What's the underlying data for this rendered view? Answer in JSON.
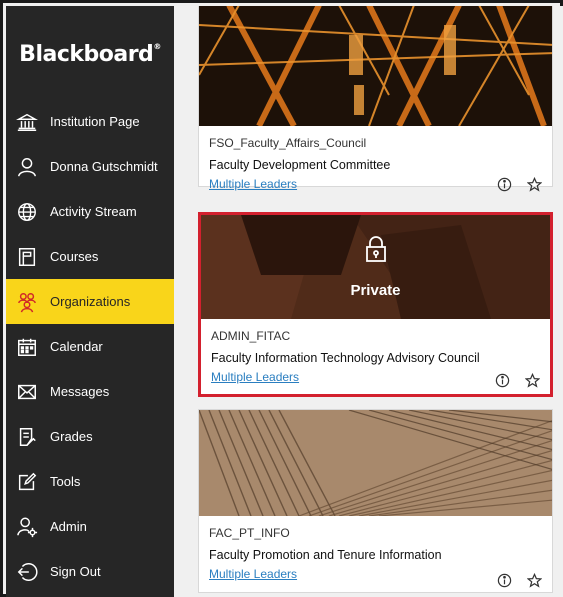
{
  "brand": "Blackboard",
  "nav": [
    {
      "label": "Institution Page",
      "icon": "institution-icon"
    },
    {
      "label": "Donna Gutschmidt",
      "icon": "user-icon"
    },
    {
      "label": "Activity Stream",
      "icon": "globe-icon"
    },
    {
      "label": "Courses",
      "icon": "courses-icon"
    },
    {
      "label": "Organizations",
      "icon": "organizations-icon",
      "active": true
    },
    {
      "label": "Calendar",
      "icon": "calendar-icon"
    },
    {
      "label": "Messages",
      "icon": "envelope-icon"
    },
    {
      "label": "Grades",
      "icon": "grades-icon"
    },
    {
      "label": "Tools",
      "icon": "tools-icon"
    },
    {
      "label": "Admin",
      "icon": "admin-icon"
    },
    {
      "label": "Sign Out",
      "icon": "sign-out-icon"
    }
  ],
  "cards": [
    {
      "id": "FSO_Faculty_Affairs_Council",
      "name": "Faculty Development Committee",
      "leaders": "Multiple Leaders"
    },
    {
      "id": "ADMIN_FITAC",
      "name": "Faculty Information Technology Advisory Council",
      "leaders": "Multiple Leaders",
      "private_label": "Private"
    },
    {
      "id": "FAC_PT_INFO",
      "name": "Faculty Promotion and Tenure Information",
      "leaders": "Multiple Leaders"
    }
  ],
  "colors": {
    "sidebar": "#262626",
    "active": "#f9d51a",
    "highlight": "#d3202e",
    "link": "#2a7ec0"
  }
}
